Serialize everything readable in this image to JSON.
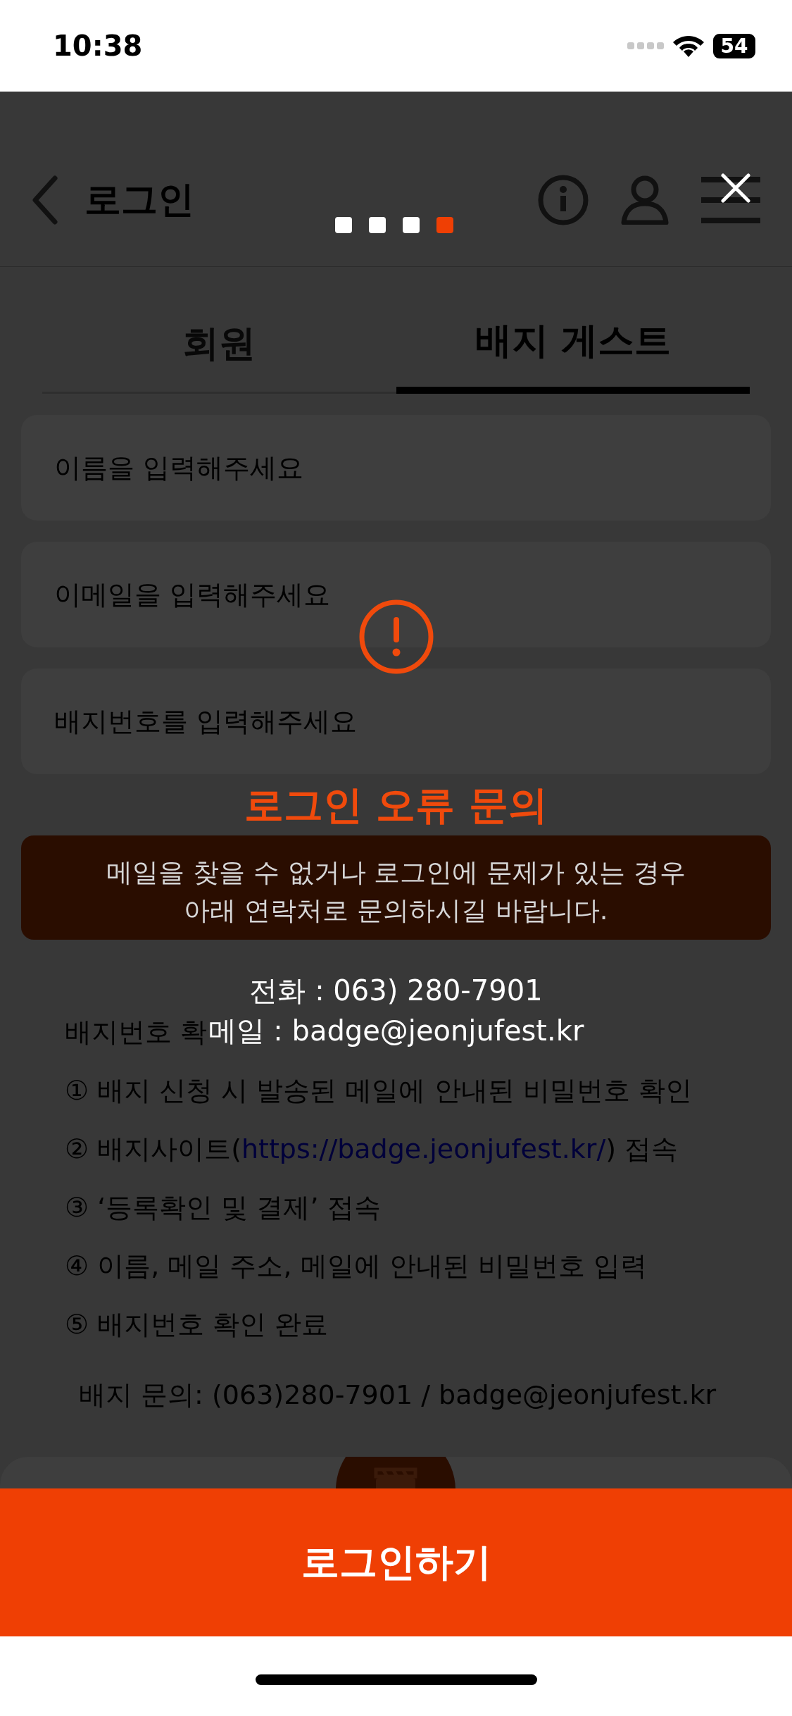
{
  "status_bar": {
    "time": "10:38",
    "battery": "54"
  },
  "header": {
    "title": "로그인"
  },
  "tour_dots": [
    {
      "selected": false
    },
    {
      "selected": false
    },
    {
      "selected": false
    },
    {
      "selected": true
    }
  ],
  "tabs": [
    {
      "label": "회원",
      "selected": false
    },
    {
      "label": "배지 게스트",
      "selected": true
    }
  ],
  "fields": [
    {
      "placeholder": "이름을 입력해주세요"
    },
    {
      "placeholder": "이메일을 입력해주세요"
    },
    {
      "placeholder": "배지번호를 입력해주세요"
    }
  ],
  "guide": {
    "title": "배지번호 확",
    "steps": [
      {
        "text": "① 배지 신청 시 발송된 메일에 안내된 비밀번호 확인"
      },
      {
        "text": "② 배지사이트(",
        "link": "https://badge.jeonjufest.kr/",
        "after": ") 접속"
      },
      {
        "text": "③ ‘등록확인 및 결제’ 접속"
      },
      {
        "text": "④ 이름, 메일 주소, 메일에 안내된 비밀번호 입력"
      },
      {
        "text": "⑤ 배지번호 확인 완료"
      }
    ],
    "contact": "배지 문의: (063)280-7901 / badge@jeonjufest.kr"
  },
  "overlay": {
    "title": "로그인 오류 문의",
    "message": [
      "메일을 찾을 수 없거나 로그인에 문제가 있는 경우",
      "아래 연락처로 문의하시길 바랍니다."
    ],
    "contacts": [
      "전화 : 063) 280-7901",
      "메일 : badge@jeonjufest.kr"
    ]
  },
  "login_button": "로그인하기"
}
